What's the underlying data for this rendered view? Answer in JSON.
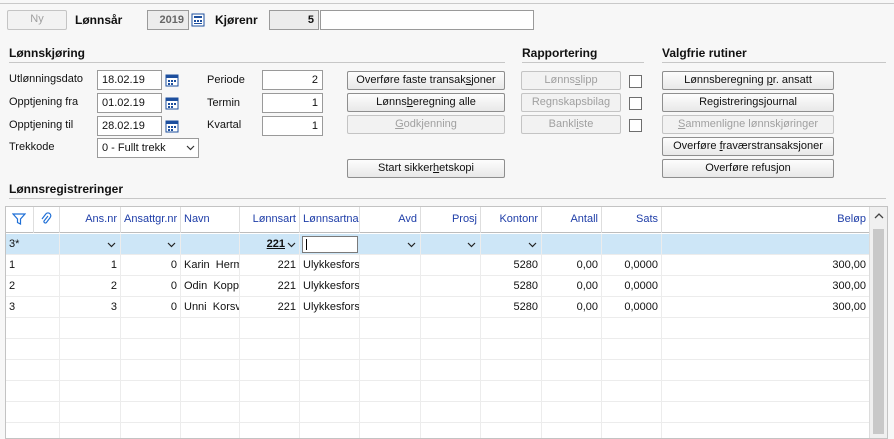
{
  "top": {
    "new_button": "Ny",
    "year_label": "Lønnsår",
    "year_value": "2019",
    "run_label": "Kjørenr",
    "run_value": "5",
    "run_desc": ""
  },
  "lonnskjoring": {
    "title": "Lønnskjøring",
    "title_underline_char": "j",
    "fields": [
      {
        "label": "Utlønningsdato",
        "value": "18.02.19"
      },
      {
        "label": "Opptjening fra",
        "value": "01.02.19"
      },
      {
        "label": "Opptjening til",
        "value": "28.02.19"
      }
    ],
    "trekkode_label": "Trekkode",
    "trekkode_value": "0 - Fullt trekk",
    "periode_label": "Periode",
    "periode_value": "2",
    "termin_label": "Termin",
    "termin_value": "1",
    "kvartal_label": "Kvartal",
    "kvartal_value": "1"
  },
  "actions": {
    "overfore_faste": "Overføre faste transaksjoner",
    "lonnsberegning_alle": "Lønnsberegning alle",
    "godkjenning": "Godkjenning",
    "start_sikkerhetskopi": "Start sikkerhetskopi"
  },
  "rapportering": {
    "title": "Rapportering",
    "items": [
      "Lønnsslipp",
      "Regnskapsbilag",
      "Bankliste"
    ]
  },
  "valgfrie": {
    "title": "Valgfrie rutiner",
    "items": [
      {
        "label": "Lønnsberegning pr. ansatt",
        "enabled": true
      },
      {
        "label": "Registreringsjournal",
        "enabled": true
      },
      {
        "label": "Sammenligne lønnskjøringer",
        "enabled": false
      },
      {
        "label": "Overføre fraværstransaksjoner",
        "enabled": true
      },
      {
        "label": "Overføre refusjon",
        "enabled": true
      }
    ]
  },
  "grid": {
    "title": "Lønnsregistreringer",
    "columns": [
      "Ans.nr",
      "Ansattgr.nr",
      "Navn",
      "Lønnsart",
      "Lønnsartna",
      "Avd",
      "Prosj",
      "Kontonr",
      "Antall",
      "Sats",
      "Beløp"
    ],
    "filter_row": {
      "label": "3*",
      "lonnsart": "221"
    },
    "rows": [
      {
        "idx": "1",
        "ansnr": "1",
        "ansgr": "0",
        "navn": "Karin  Herm",
        "lonnsart": "221",
        "lonnsartna": "Ulykkesfors",
        "kontonr": "5280",
        "antall": "0,00",
        "sats": "0,0000",
        "belop": "300,00"
      },
      {
        "idx": "2",
        "ansnr": "2",
        "ansgr": "0",
        "navn": "Odin  Koppa",
        "lonnsart": "221",
        "lonnsartna": "Ulykkesfors",
        "kontonr": "5280",
        "antall": "0,00",
        "sats": "0,0000",
        "belop": "300,00"
      },
      {
        "idx": "3",
        "ansnr": "3",
        "ansgr": "0",
        "navn": "Unni  Korsv",
        "lonnsart": "221",
        "lonnsartna": "Ulykkesfors",
        "kontonr": "5280",
        "antall": "0,00",
        "sats": "0,0000",
        "belop": "300,00"
      }
    ]
  },
  "icons": [
    "calendar-icon",
    "filter-icon",
    "paperclip-icon",
    "chevron-down-icon",
    "scroll-up-icon"
  ],
  "colors": {
    "header_text": "#1f3ea8",
    "selected_row": "#cde6f7"
  }
}
